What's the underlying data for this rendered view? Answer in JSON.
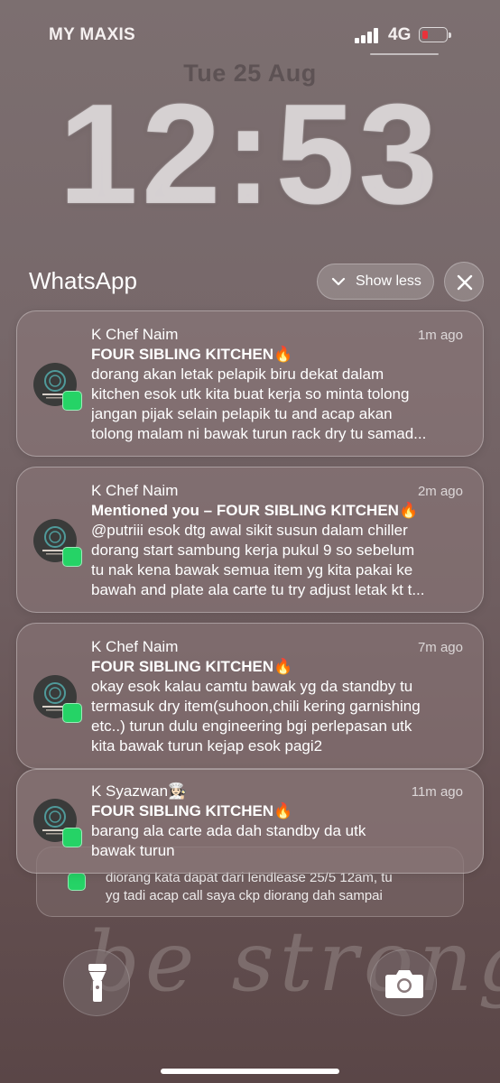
{
  "status_bar": {
    "carrier": "MY MAXIS",
    "network": "4G",
    "signal_bars": 4,
    "battery_level": 0.15,
    "battery_color": "#e8323a"
  },
  "lock_screen": {
    "date": "Tue 25 Aug",
    "time": "12:53"
  },
  "app_group": {
    "app_name": "WhatsApp",
    "show_less_label": "Show less",
    "show_less_icon": "chevron-down-icon",
    "close_icon": "close-icon"
  },
  "notifications": [
    {
      "sender": "K Chef Naim",
      "time": "1m ago",
      "title": "FOUR SIBLING KITCHEN🔥",
      "body_lines": [
        "dorang akan letak pelapik biru dekat dalam",
        "kitchen esok utk kita buat kerja so minta tolong",
        "jangan pijak selain pelapik tu and acap akan",
        "tolong malam ni bawak turun rack dry tu samad..."
      ],
      "avatar_text": "FOUR SIBLING KITCHEN"
    },
    {
      "sender": "K Chef Naim",
      "time": "2m ago",
      "title": "Mentioned you – FOUR SIBLING KITCHEN🔥",
      "body_lines": [
        "@putriii esok dtg awal sikit susun dalam chiller",
        "dorang start sambung kerja pukul 9 so sebelum",
        "tu nak kena bawak semua item yg kita pakai ke",
        "bawah and plate ala carte tu try adjust letak kt t..."
      ],
      "avatar_text": "FOUR SIBLING KITCHEN"
    },
    {
      "sender": "K Chef Naim",
      "time": "7m ago",
      "title": "FOUR SIBLING KITCHEN🔥",
      "body_lines": [
        "okay esok kalau camtu bawak yg da standby tu",
        "termasuk dry item(suhoon,chili kering garnishing",
        "etc..) turun dulu engineering bgi perlepasan utk",
        "kita bawak turun kejap esok pagi2"
      ],
      "avatar_text": "FOUR SIBLING KITCHEN"
    },
    {
      "sender": "K Syazwan👩🏻‍🍳",
      "time": "11m ago",
      "title": "FOUR SIBLING KITCHEN🔥",
      "body_lines": [
        "barang ala carte ada dah standby da utk",
        "bawak turun"
      ],
      "avatar_text": "FOUR SIBLING KITCHEN"
    }
  ],
  "stacked_notification": {
    "body_lines": [
      "diorang kata dapat dari lendlease 25/5 12am, tu",
      "yg tadi acap call saya ckp diorang dah sampai"
    ]
  },
  "wallpaper": {
    "text": "be strong"
  },
  "quick_actions": {
    "flashlight_icon": "flashlight-icon",
    "camera_icon": "camera-icon"
  },
  "colors": {
    "whatsapp_green": "#25d366",
    "avatar_teal": "#4f9a9a"
  }
}
